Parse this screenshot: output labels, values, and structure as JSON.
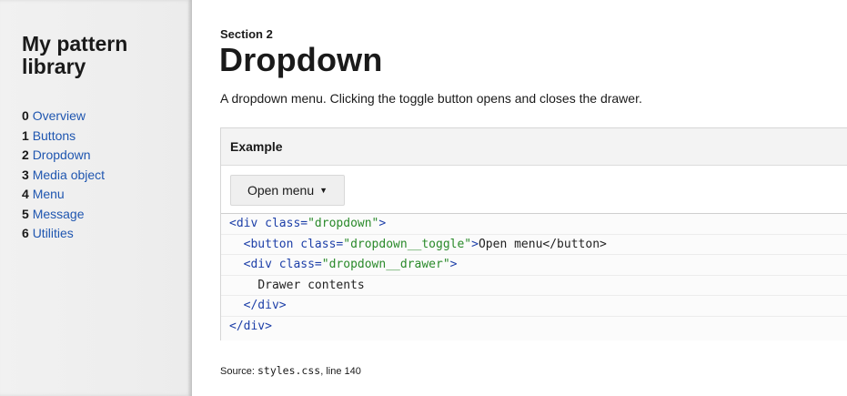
{
  "sidebar": {
    "title": "My pattern library",
    "items": [
      {
        "num": "0",
        "label": "Overview"
      },
      {
        "num": "1",
        "label": "Buttons"
      },
      {
        "num": "2",
        "label": "Dropdown"
      },
      {
        "num": "3",
        "label": "Media object"
      },
      {
        "num": "4",
        "label": "Menu"
      },
      {
        "num": "5",
        "label": "Message"
      },
      {
        "num": "6",
        "label": "Utilities"
      }
    ]
  },
  "main": {
    "section_label": "Section 2",
    "title": "Dropdown",
    "description": "A dropdown menu. Clicking the toggle button opens and closes the drawer.",
    "example": {
      "header": "Example",
      "button_label": "Open menu",
      "caret": "▼",
      "code_lines": [
        [
          "<div ",
          "class=",
          "\"dropdown\"",
          ">",
          ""
        ],
        [
          "  <button ",
          "class=",
          "\"dropdown__toggle\"",
          ">",
          "Open menu</button>"
        ],
        [
          "  <div ",
          "class=",
          "\"dropdown__drawer\"",
          ">",
          ""
        ],
        [
          "    ",
          "",
          "",
          "",
          "Drawer contents"
        ],
        [
          "  </div>",
          "",
          "",
          "",
          ""
        ],
        [
          "</div>",
          "",
          "",
          "",
          ""
        ]
      ]
    },
    "source": {
      "prefix": "Source: ",
      "file": "styles.css",
      "suffix": ", line 140"
    }
  },
  "colors": {
    "link": "#1f56b0",
    "code_tag": "#1d3fa8",
    "code_string": "#2a8a2a"
  }
}
